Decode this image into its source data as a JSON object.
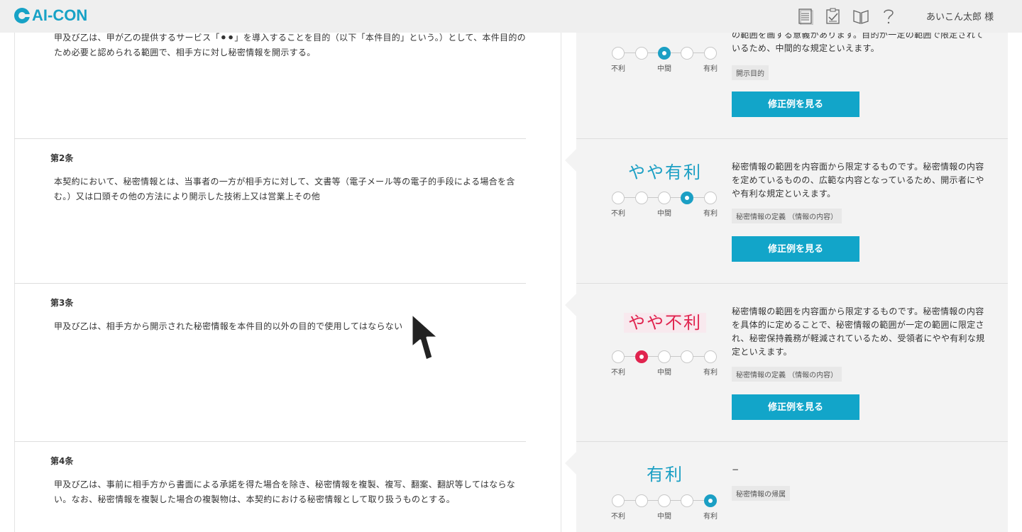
{
  "header": {
    "logo_text": "AI-CON",
    "user_name": "あいこん太郎 様",
    "icons": [
      "document-list-icon",
      "checklist-icon",
      "book-icon",
      "help-icon"
    ],
    "accent_color": "#17a2c6"
  },
  "articles": [
    {
      "title": "",
      "body": "甲及び乙は、甲が乙の提供するサービス「⚫⚫」を導入することを目的（以下「本件目的」という。）として、本件目的のため必要と認められる範囲で、相手方に対し秘密情報を開示する。"
    },
    {
      "title": "第2条",
      "body": "本契約において、秘密情報とは、当事者の一方が相手方に対して、文書等（電子メール等の電子的手段による場合を含む。）又は口頭その他の方法により開示した技術上又は営業上その他"
    },
    {
      "title": "第3条",
      "body": "甲及び乙は、相手方から開示された秘密情報を本件目的以外の目的で使用してはならない"
    },
    {
      "title": "第4条",
      "body": "甲及び乙は、事前に相手方から書面による承諾を得た場合を除き、秘密情報を複製、複写、翻案、翻訳等してはならない。なお、秘密情報を複製した場合の複製物は、本契約における秘密情報として取り扱うものとする。"
    }
  ],
  "scale_labels": {
    "left": "不利",
    "middle": "中間",
    "right": "有利"
  },
  "reviews": [
    {
      "rating": "",
      "rating_color": "#1b9fc4",
      "selected_index": 2,
      "description": "の範囲を画する意義があります。目的が一定の範囲で限定されているため、中間的な規定といえます。",
      "tag": "開示目的",
      "button_label": "修正例を見る"
    },
    {
      "rating": "やや有利",
      "rating_color": "#1b9fc4",
      "selected_index": 3,
      "description": "秘密情報の範囲を内容面から限定するものです。秘密情報の内容を定めているものの、広範な内容となっているため、開示者にやや有利な規定といえます。",
      "tag": "秘密情報の定義 （情報の内容）",
      "button_label": "修正例を見る"
    },
    {
      "rating": "やや不利",
      "rating_color": "#e0244f",
      "selected_index": 1,
      "description": "秘密情報の範囲を内容面から限定するものです。秘密情報の内容を具体的に定めることで、秘密情報の範囲が一定の範囲に限定され、秘密保持義務が軽減されているため、受領者にやや有利な規定といえます。",
      "tag": "秘密情報の定義 （情報の内容）",
      "button_label": "修正例を見る"
    },
    {
      "rating": "有利",
      "rating_color": "#1b9fc4",
      "selected_index": 4,
      "description": "−",
      "tag": "秘密情報の帰属",
      "button_label": ""
    }
  ]
}
